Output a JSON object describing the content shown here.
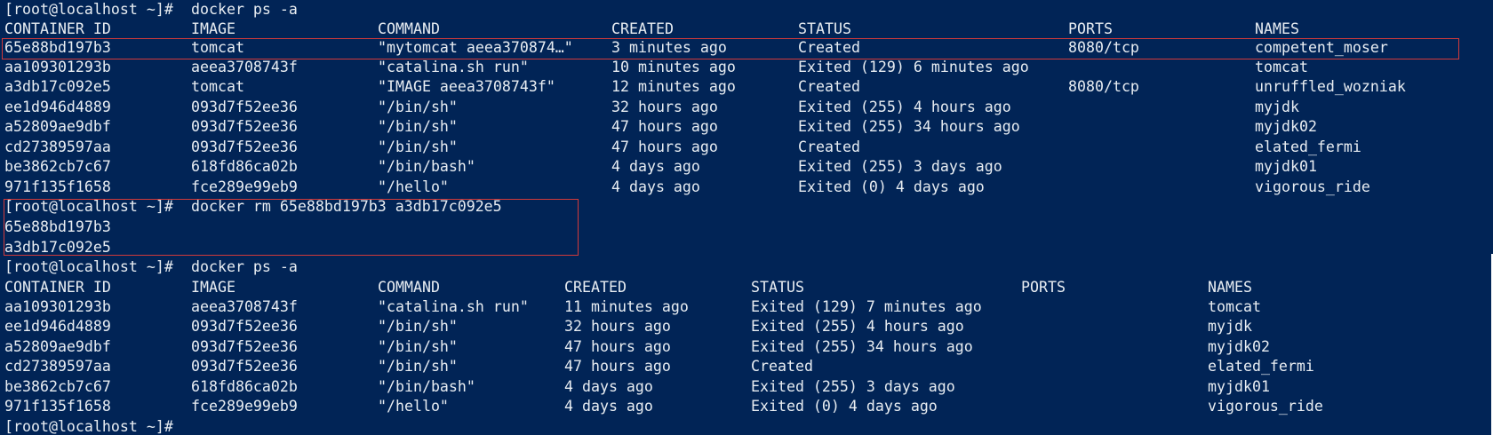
{
  "terminal": {
    "prompt": "[root@localhost ~]#",
    "command_ps": "docker ps -a",
    "command_rm": "docker rm 65e88bd197b3 a3db17c092e5",
    "rm_output": [
      "65e88bd197b3",
      "a3db17c092e5"
    ],
    "headers": [
      "CONTAINER ID",
      "IMAGE",
      "COMMAND",
      "CREATED",
      "STATUS",
      "PORTS",
      "NAMES"
    ],
    "table1": [
      [
        "65e88bd197b3",
        "tomcat",
        "\"mytomcat aeea370874…\"",
        "3 minutes ago",
        "Created",
        "8080/tcp",
        "competent_moser"
      ],
      [
        "aa109301293b",
        "aeea3708743f",
        "\"catalina.sh run\"",
        "10 minutes ago",
        "Exited (129) 6 minutes ago",
        "",
        "tomcat"
      ],
      [
        "a3db17c092e5",
        "tomcat",
        "\"IMAGE aeea3708743f\"",
        "12 minutes ago",
        "Created",
        "8080/tcp",
        "unruffled_wozniak"
      ],
      [
        "ee1d946d4889",
        "093d7f52ee36",
        "\"/bin/sh\"",
        "32 hours ago",
        "Exited (255) 4 hours ago",
        "",
        "myjdk"
      ],
      [
        "a52809ae9dbf",
        "093d7f52ee36",
        "\"/bin/sh\"",
        "47 hours ago",
        "Exited (255) 34 hours ago",
        "",
        "myjdk02"
      ],
      [
        "cd27389597aa",
        "093d7f52ee36",
        "\"/bin/sh\"",
        "47 hours ago",
        "Created",
        "",
        "elated_fermi"
      ],
      [
        "be3862cb7c67",
        "618fd86ca02b",
        "\"/bin/bash\"",
        "4 days ago",
        "Exited (255) 3 days ago",
        "",
        "myjdk01"
      ],
      [
        "971f135f1658",
        "fce289e99eb9",
        "\"/hello\"",
        "4 days ago",
        "Exited (0) 4 days ago",
        "",
        "vigorous_ride"
      ]
    ],
    "table2": [
      [
        "aa109301293b",
        "aeea3708743f",
        "\"catalina.sh run\"",
        "11 minutes ago",
        "Exited (129) 7 minutes ago",
        "",
        "tomcat"
      ],
      [
        "ee1d946d4889",
        "093d7f52ee36",
        "\"/bin/sh\"",
        "32 hours ago",
        "Exited (255) 4 hours ago",
        "",
        "myjdk"
      ],
      [
        "a52809ae9dbf",
        "093d7f52ee36",
        "\"/bin/sh\"",
        "47 hours ago",
        "Exited (255) 34 hours ago",
        "",
        "myjdk02"
      ],
      [
        "cd27389597aa",
        "093d7f52ee36",
        "\"/bin/sh\"",
        "47 hours ago",
        "Created",
        "",
        "elated_fermi"
      ],
      [
        "be3862cb7c67",
        "618fd86ca02b",
        "\"/bin/bash\"",
        "4 days ago",
        "Exited (255) 3 days ago",
        "",
        "myjdk01"
      ],
      [
        "971f135f1658",
        "fce289e99eb9",
        "\"/hello\"",
        "4 days ago",
        "Exited (0) 4 days ago",
        "",
        "vigorous_ride"
      ]
    ]
  },
  "colors": {
    "background": "#012456",
    "foreground": "#e8edf2",
    "highlight": "#d23a3a"
  }
}
